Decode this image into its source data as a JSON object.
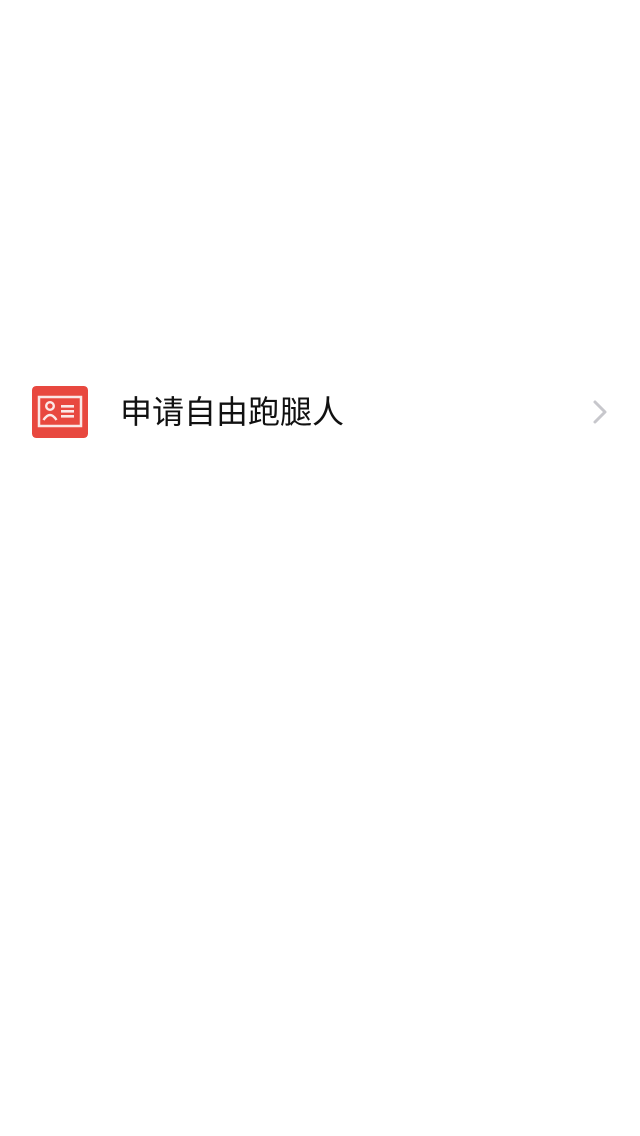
{
  "colors": {
    "background": "#ffffff",
    "icon_background": "#e8483f",
    "icon_foreground": "#fbe7e6",
    "label_text": "#111111",
    "chevron": "#c7c7cc"
  },
  "menu": {
    "items": [
      {
        "icon": "id-card-icon",
        "label": "申请自由跑腿人",
        "trailing_icon": "chevron-right-icon"
      }
    ]
  }
}
